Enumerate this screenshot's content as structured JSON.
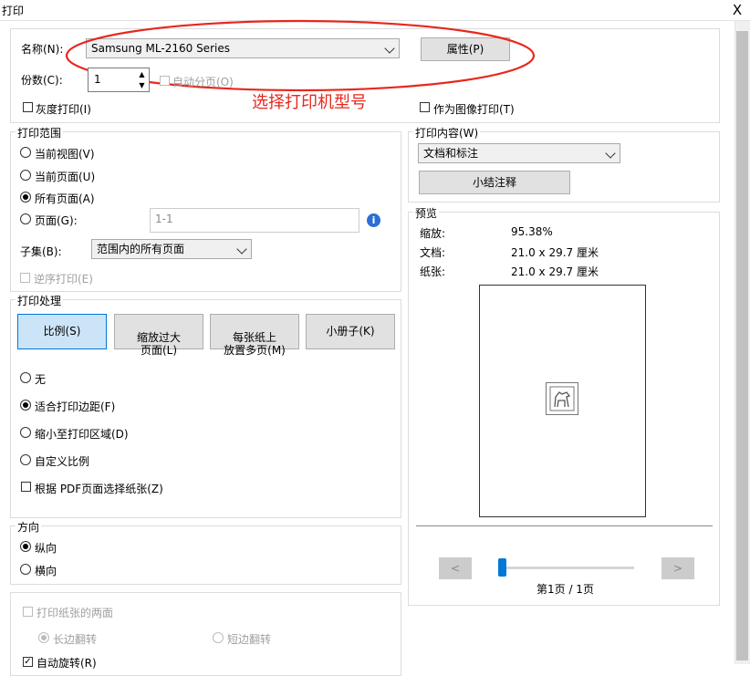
{
  "window": {
    "title": "打印",
    "close": "X"
  },
  "printer": {
    "name_label": "名称(N):",
    "name_value": "Samsung ML-2160 Series",
    "properties_button": "属性(P)",
    "copies_label": "份数(C):",
    "copies_value": "1",
    "collate_label": "自动分页(O)",
    "grayscale_label": "灰度打印(I)",
    "image_print_label": "作为图像打印(T)",
    "annotation": "选择打印机型号",
    "annotation_color": "#e8271c"
  },
  "range": {
    "title": "打印范围",
    "options": [
      "当前视图(V)",
      "当前页面(U)",
      "所有页面(A)",
      "页面(G):"
    ],
    "selected": "所有页面(A)",
    "pages_value": "1-1",
    "subset_label": "子集(B):",
    "subset_value": "范围内的所有页面",
    "reverse_label": "逆序打印(E)"
  },
  "handling": {
    "title": "打印处理",
    "tabs": [
      {
        "label": "比例(S)",
        "active": true
      },
      {
        "label": "缩放过大\n页面(L)",
        "active": false
      },
      {
        "label": "每张纸上\n放置多页(M)",
        "active": false
      },
      {
        "label": "小册子(K)",
        "active": false
      }
    ],
    "options": [
      "无",
      "适合打印边距(F)",
      "缩小至打印区域(D)",
      "自定义比例"
    ],
    "selected": "适合打印边距(F)",
    "pdf_paper_label": "根据 PDF页面选择纸张(Z)"
  },
  "orientation": {
    "title": "方向",
    "options": [
      "纵向",
      "横向"
    ],
    "selected": "纵向"
  },
  "duplex": {
    "both_sides_label": "打印纸张的两面",
    "long_edge": "长边翻转",
    "short_edge": "短边翻转",
    "auto_rotate": "自动旋转(R)"
  },
  "content": {
    "title": "打印内容(W)",
    "value": "文档和标注",
    "summarize_button": "小结注释"
  },
  "preview": {
    "title": "预览",
    "zoom_label": "缩放:",
    "zoom_value": "95.38%",
    "document_label": "文档:",
    "document_value": "21.0 x 29.7 厘米",
    "paper_label": "纸张:",
    "paper_value": "21.0 x 29.7 厘米",
    "prev": "<",
    "next": ">",
    "page_indicator": "第1页 / 1页",
    "slider_color": "#0078d7"
  }
}
